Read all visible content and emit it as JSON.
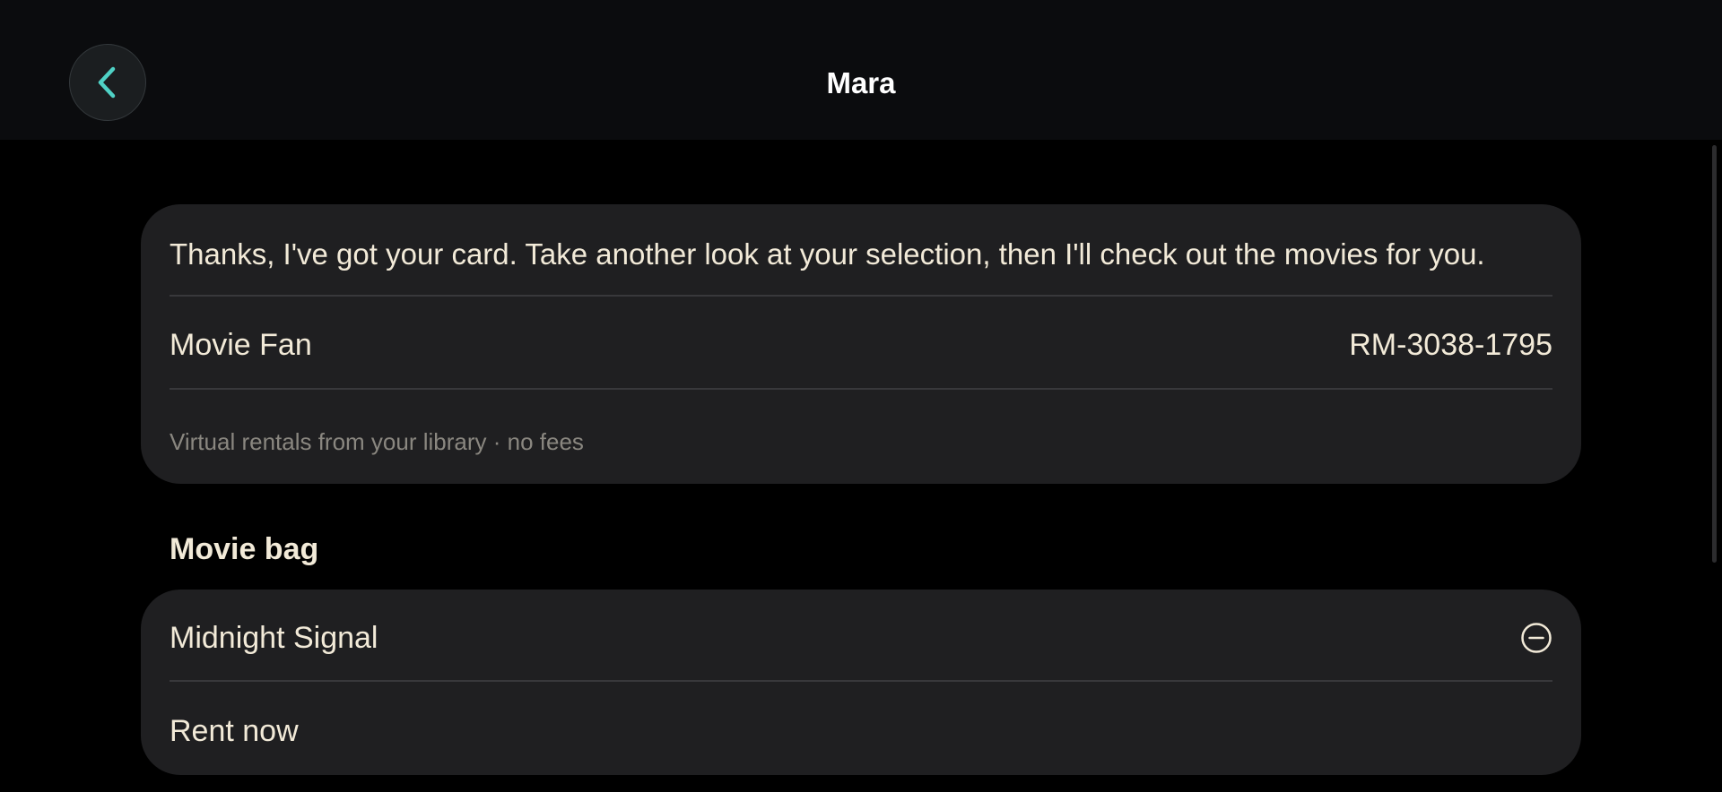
{
  "header": {
    "title": "Mara",
    "back_icon": "chevron-left-icon",
    "accent_color": "#4fd1c5"
  },
  "info_card": {
    "message": "Thanks, I've got your card. Take another look at your selection, then I'll check out the movies for you.",
    "membership_label": "Movie Fan",
    "membership_id": "RM-3038-1795",
    "note": "Virtual rentals from your library · no fees"
  },
  "movie_bag": {
    "title": "Movie bag",
    "items": [
      {
        "title": "Midnight Signal",
        "action_icon": "minus-circle-icon"
      }
    ],
    "rent_label": "Rent now"
  }
}
